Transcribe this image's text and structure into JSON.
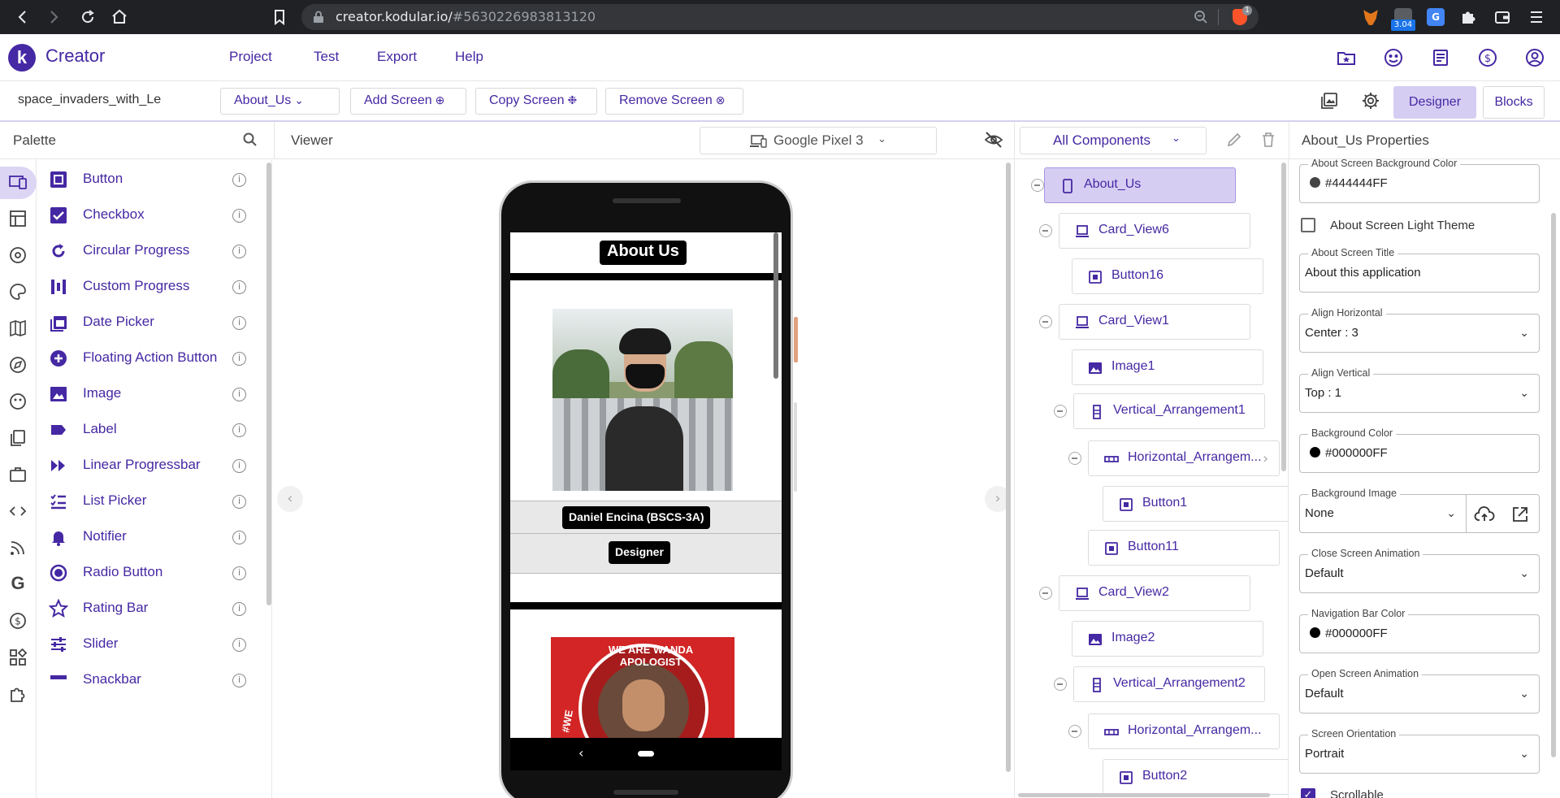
{
  "browser": {
    "url_domain": "creator.kodular.io/",
    "url_hash": "#5630226983813120",
    "extension_badge": "3.04",
    "brave_badge": "1"
  },
  "header": {
    "logo_letter": "k",
    "app_name": "Creator",
    "menu": [
      "Project",
      "Test",
      "Export",
      "Help"
    ]
  },
  "toolbar": {
    "project_name": "space_invaders_with_Le",
    "screen_select": "About_Us",
    "add_screen": "Add Screen",
    "copy_screen": "Copy Screen",
    "remove_screen": "Remove Screen",
    "designer": "Designer",
    "blocks": "Blocks"
  },
  "palette": {
    "title": "Palette",
    "items": [
      {
        "label": "Button",
        "icon": "button-icon"
      },
      {
        "label": "Checkbox",
        "icon": "checkbox-icon"
      },
      {
        "label": "Circular Progress",
        "icon": "circular-progress-icon"
      },
      {
        "label": "Custom Progress",
        "icon": "custom-progress-icon"
      },
      {
        "label": "Date Picker",
        "icon": "date-picker-icon"
      },
      {
        "label": "Floating Action Button",
        "icon": "fab-icon"
      },
      {
        "label": "Image",
        "icon": "image-icon"
      },
      {
        "label": "Label",
        "icon": "label-icon"
      },
      {
        "label": "Linear Progressbar",
        "icon": "linear-progress-icon"
      },
      {
        "label": "List Picker",
        "icon": "list-picker-icon"
      },
      {
        "label": "Notifier",
        "icon": "bell-icon"
      },
      {
        "label": "Radio Button",
        "icon": "radio-icon"
      },
      {
        "label": "Rating Bar",
        "icon": "star-icon"
      },
      {
        "label": "Slider",
        "icon": "slider-icon"
      },
      {
        "label": "Snackbar",
        "icon": "snackbar-icon"
      }
    ]
  },
  "viewer": {
    "title": "Viewer",
    "device": "Google Pixel 3",
    "screen_title": "About Us",
    "person_name": "Daniel Encina (BSCS-3A)",
    "role": "Designer",
    "badge_text": "WE ARE WANDA APOLOGIST",
    "badge_side": "#WE"
  },
  "components": {
    "filter": "All Components",
    "nodes": [
      {
        "label": "About_Us",
        "icon": "phone-icon"
      },
      {
        "label": "Card_View6",
        "icon": "card-icon"
      },
      {
        "label": "Button16",
        "icon": "button-icon"
      },
      {
        "label": "Card_View1",
        "icon": "card-icon"
      },
      {
        "label": "Image1",
        "icon": "image-icon"
      },
      {
        "label": "Vertical_Arrangement1",
        "icon": "vertical-arrangement-icon"
      },
      {
        "label": "Horizontal_Arrangem...",
        "icon": "horizontal-arrangement-icon"
      },
      {
        "label": "Button1",
        "icon": "button-icon"
      },
      {
        "label": "Button11",
        "icon": "button-icon"
      },
      {
        "label": "Card_View2",
        "icon": "card-icon"
      },
      {
        "label": "Image2",
        "icon": "image-icon"
      },
      {
        "label": "Vertical_Arrangement2",
        "icon": "vertical-arrangement-icon"
      },
      {
        "label": "Horizontal_Arrangem...",
        "icon": "horizontal-arrangement-icon"
      },
      {
        "label": "Button2",
        "icon": "button-icon"
      }
    ]
  },
  "properties": {
    "title": "About_Us Properties",
    "bg_color_label": "About Screen Background Color",
    "bg_color_value": "#444444FF",
    "light_theme_label": "About Screen Light Theme",
    "title_label": "About Screen Title",
    "title_value": "About this application",
    "align_h_label": "Align Horizontal",
    "align_h_value": "Center : 3",
    "align_v_label": "Align Vertical",
    "align_v_value": "Top : 1",
    "background_color_label": "Background Color",
    "background_color_value": "#000000FF",
    "background_image_label": "Background Image",
    "background_image_value": "None",
    "close_anim_label": "Close Screen Animation",
    "close_anim_value": "Default",
    "nav_color_label": "Navigation Bar Color",
    "nav_color_value": "#000000FF",
    "open_anim_label": "Open Screen Animation",
    "open_anim_value": "Default",
    "orientation_label": "Screen Orientation",
    "orientation_value": "Portrait",
    "scrollable_label": "Scrollable"
  },
  "colors": {
    "accent": "#4528a3",
    "accent_light": "#d6cdf3",
    "swatch_grey": "#444444",
    "swatch_black": "#000000"
  }
}
